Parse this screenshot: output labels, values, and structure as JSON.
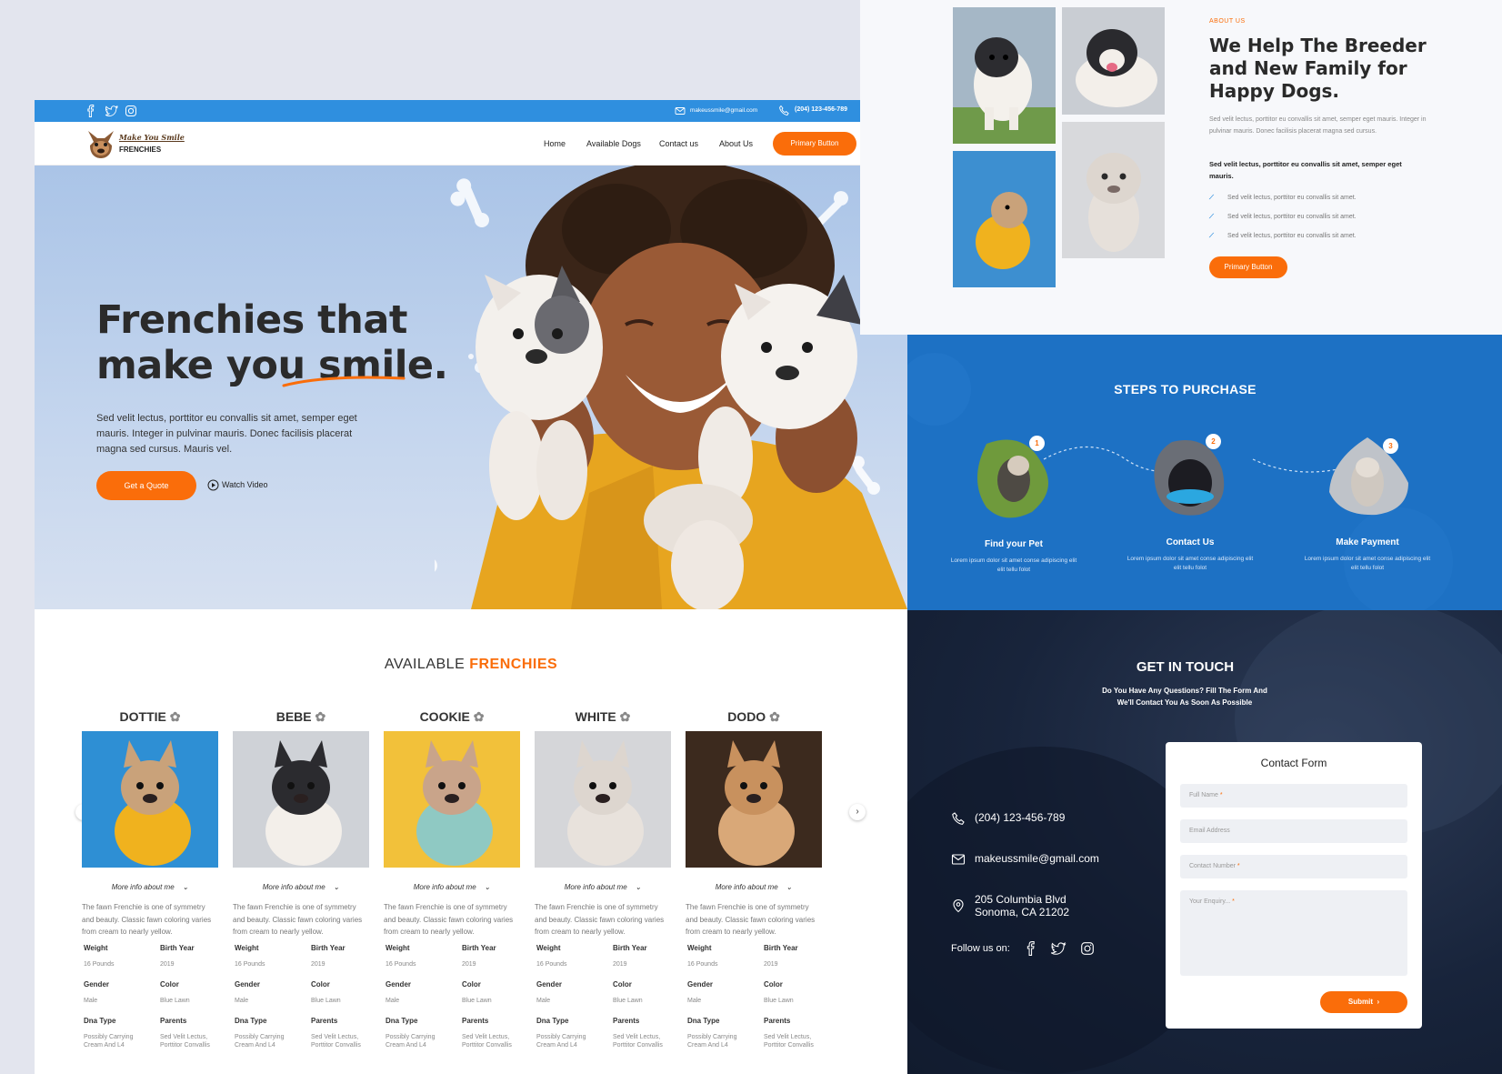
{
  "topbar": {
    "email": "makeussmile@gmail.com",
    "phone": "(204) 123-456-789"
  },
  "nav": {
    "logo_script": "Make You Smile",
    "logo_name": "FRENCHIES",
    "links": [
      "Home",
      "Available Dogs",
      "Contact us",
      "About Us"
    ],
    "cta": "Primary Button"
  },
  "hero": {
    "title_line1": "Frenchies that",
    "title_line2": "make you smile.",
    "description": "Sed velit lectus, porttitor eu convallis sit amet, semper eget mauris. Integer in pulvinar mauris. Donec facilisis placerat magna sed cursus. Mauris vel.",
    "quote_button": "Get a Quote",
    "video_button": "Watch Video"
  },
  "available": {
    "title_part1": "AVAILABLE",
    "title_part2": "FRENCHIES",
    "more_info": "More info about me",
    "blurb": "The fawn Frenchie is one of symmetry and beauty. Classic fawn coloring varies from cream to nearly yellow.",
    "labels": {
      "weight": "Weight",
      "birth_year": "Birth Year",
      "gender": "Gender",
      "color": "Color",
      "dna": "Dna Type",
      "parents": "Parents"
    },
    "values": {
      "weight": "16 Pounds",
      "birth_year": "2019",
      "gender": "Male",
      "color": "Blue Lawn",
      "dna": "Possibly Carrying Cream And L4",
      "parents": "Sed Velit Lectus, Porttitor Convallis"
    },
    "dogs": [
      "DOTTIE",
      "BEBE",
      "COOKIE",
      "WHITE",
      "DODO"
    ]
  },
  "about": {
    "eyebrow": "ABOUT US",
    "title": "We Help The Breeder and New Family for Happy Dogs.",
    "para1": "Sed velit lectus, porttitor eu convallis sit amet, semper eget mauris. Integer in pulvinar mauris. Donec facilisis placerat magna sed cursus.",
    "para2": "Sed velit lectus, porttitor eu convallis sit amet, semper eget mauris.",
    "bullets": [
      "Sed velit lectus, porttitor eu convallis sit amet.",
      "Sed velit lectus, porttitor eu convallis sit amet.",
      "Sed velit lectus, porttitor eu convallis sit amet."
    ],
    "button": "Primary Button"
  },
  "steps": {
    "title": "STEPS TO PURCHASE",
    "items": [
      {
        "num": "1",
        "title": "Find your Pet",
        "desc": "Lorem ipsum dolor sit amet conse adipiscing elit elit tellu folot"
      },
      {
        "num": "2",
        "title": "Contact Us",
        "desc": "Lorem ipsum dolor sit amet conse adipiscing elit elit tellu folot"
      },
      {
        "num": "3",
        "title": "Make Payment",
        "desc": "Lorem ipsum dolor sit amet conse adipiscing elit elit tellu folot"
      }
    ]
  },
  "contact": {
    "title": "GET IN TOUCH",
    "subtitle": "Do You Have Any Questions? Fill The Form And We'll Contact You As Soon As Possible",
    "phone": "(204) 123-456-789",
    "email": "makeussmile@gmail.com",
    "address": "205 Columbia Blvd Sonoma, CA 21202",
    "follow": "Follow us on:",
    "form": {
      "title": "Contact Form",
      "full_name": "Full Name",
      "email": "Email Address",
      "contact_number": "Contact Number",
      "enquiry": "Your Enquiry...",
      "required_mark": "*",
      "submit": "Submit"
    }
  },
  "colors": {
    "accent": "#fa6d0a",
    "primary_blue": "#2f8fdf",
    "steps_blue": "#1d71c4",
    "contact_dark": "#18243b"
  }
}
